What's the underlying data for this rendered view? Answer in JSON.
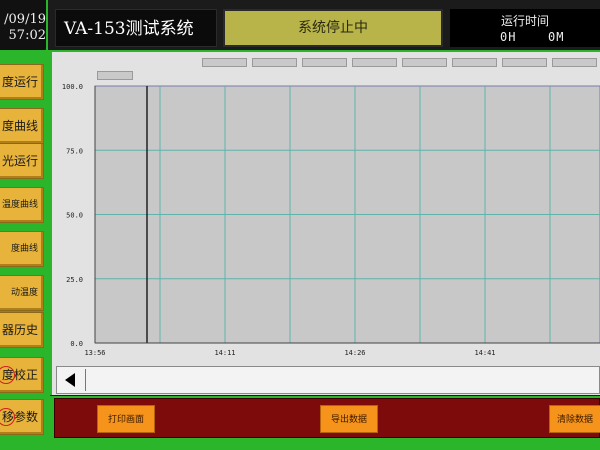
{
  "header": {
    "date": "/09/19",
    "time": "57:02",
    "system_title": "VA-153测试系统",
    "status": "系统停止中",
    "runtime_label": "运行时间",
    "runtime_hours": "0H",
    "runtime_minutes": "0M"
  },
  "sidebar": {
    "items": [
      {
        "label": "度运行"
      },
      {
        "label": "度曲线"
      },
      {
        "label": "光运行"
      },
      {
        "label": "温度曲线"
      },
      {
        "label": "度曲线"
      },
      {
        "label": "动温度"
      },
      {
        "label": "器历史"
      },
      {
        "label": "度校正"
      },
      {
        "label": "移参数"
      }
    ]
  },
  "bottom": {
    "print_label": "打印画面",
    "export_label": "导出数据",
    "clear_label": "清除数据"
  },
  "chart_data": {
    "type": "line",
    "title": "",
    "xlabel": "",
    "ylabel": "",
    "ylim": [
      0,
      100
    ],
    "yticks": [
      "100.0",
      "75.0",
      "50.0",
      "25.0",
      "0.0"
    ],
    "xticks": [
      "13:56",
      "14:11",
      "14:26",
      "14:41"
    ],
    "grid": true,
    "series": []
  },
  "colors": {
    "frame_green": "#2bb52b",
    "button_gold": "#e7b33a",
    "status_olive": "#b9b44a",
    "bottom_red": "#7d0b0b",
    "action_orange": "#f5931a",
    "grid_teal": "#5fb3a8"
  }
}
